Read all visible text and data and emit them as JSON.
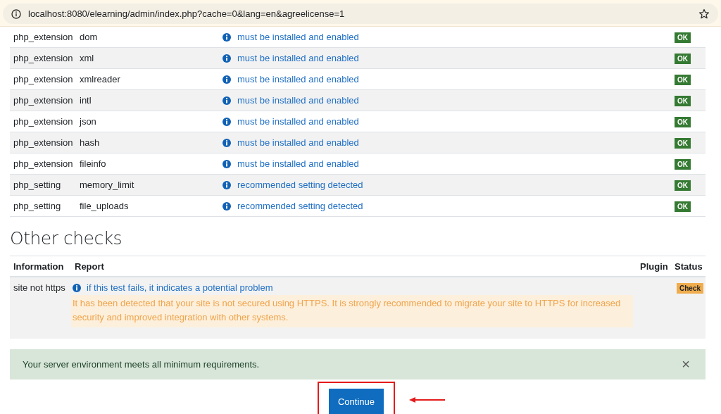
{
  "browser": {
    "url": "localhost:8080/elearning/admin/index.php?cache=0&lang=en&agreelicense=1"
  },
  "requirements": [
    {
      "type": "php_extension",
      "name": "dom",
      "report": "must be installed and enabled",
      "status": {
        "label": "OK",
        "kind": "ok"
      }
    },
    {
      "type": "php_extension",
      "name": "xml",
      "report": "must be installed and enabled",
      "status": {
        "label": "OK",
        "kind": "ok"
      }
    },
    {
      "type": "php_extension",
      "name": "xmlreader",
      "report": "must be installed and enabled",
      "status": {
        "label": "OK",
        "kind": "ok"
      }
    },
    {
      "type": "php_extension",
      "name": "intl",
      "report": "must be installed and enabled",
      "status": {
        "label": "OK",
        "kind": "ok"
      }
    },
    {
      "type": "php_extension",
      "name": "json",
      "report": "must be installed and enabled",
      "status": {
        "label": "OK",
        "kind": "ok"
      }
    },
    {
      "type": "php_extension",
      "name": "hash",
      "report": "must be installed and enabled",
      "status": {
        "label": "OK",
        "kind": "ok"
      }
    },
    {
      "type": "php_extension",
      "name": "fileinfo",
      "report": "must be installed and enabled",
      "status": {
        "label": "OK",
        "kind": "ok"
      }
    },
    {
      "type": "php_setting",
      "name": "memory_limit",
      "report": "recommended setting detected",
      "status": {
        "label": "OK",
        "kind": "ok"
      }
    },
    {
      "type": "php_setting",
      "name": "file_uploads",
      "report": "recommended setting detected",
      "status": {
        "label": "OK",
        "kind": "ok"
      }
    }
  ],
  "other_checks": {
    "title": "Other checks",
    "columns": [
      "Information",
      "Report",
      "Plugin",
      "Status"
    ],
    "rows": [
      {
        "information": "site not https",
        "report": "if this test fails, it indicates a potential problem",
        "message": "It has been detected that your site is not secured using HTTPS. It is strongly recommended to migrate your site to HTTPS for increased security and improved integration with other systems.",
        "status": {
          "label": "Check",
          "kind": "warning"
        }
      }
    ]
  },
  "alert": {
    "message": "Your server environment meets all minimum requirements.",
    "close": "×"
  },
  "continue_button": "Continue"
}
